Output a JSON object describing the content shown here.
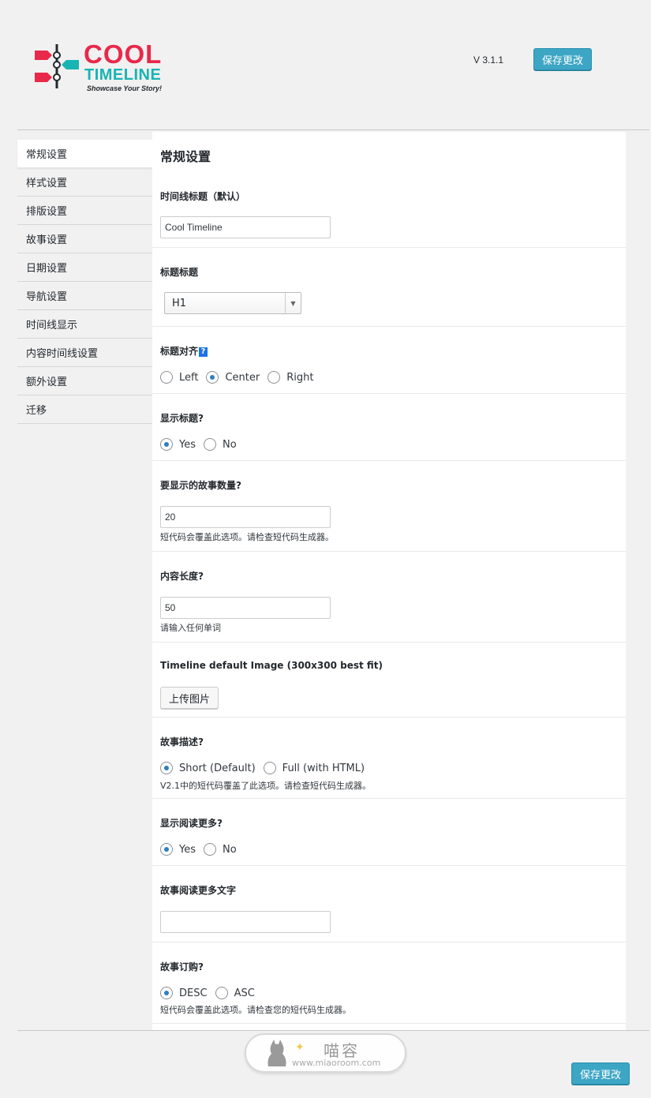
{
  "header": {
    "logo_word1": "COOL",
    "logo_word2": "TIMELINE",
    "logo_tagline": "Showcase Your Story!",
    "version": "V 3.1.1",
    "save_label": "保存更改"
  },
  "sidebar": {
    "items": [
      {
        "label": "常规设置",
        "active": true
      },
      {
        "label": "样式设置"
      },
      {
        "label": "排版设置"
      },
      {
        "label": "故事设置"
      },
      {
        "label": "日期设置"
      },
      {
        "label": "导航设置"
      },
      {
        "label": "时间线显示"
      },
      {
        "label": "内容时间线设置"
      },
      {
        "label": "额外设置"
      },
      {
        "label": "迁移"
      }
    ]
  },
  "main": {
    "title": "常规设置",
    "timeline_title": {
      "label": "时间线标题（默认）",
      "value": "Cool Timeline"
    },
    "heading_tag": {
      "label": "标题标题",
      "selected": "H1"
    },
    "title_align": {
      "label": "标题对齐",
      "help": "?",
      "options": [
        "Left",
        "Center",
        "Right"
      ],
      "selected": "Center"
    },
    "show_title": {
      "label": "显示标题?",
      "options": [
        "Yes",
        "No"
      ],
      "selected": "Yes"
    },
    "story_count": {
      "label": "要显示的故事数量?",
      "value": "20",
      "desc": "短代码会覆盖此选项。请检查短代码生成器。"
    },
    "content_length": {
      "label": "内容长度?",
      "value": "50",
      "desc": "请输入任何单词"
    },
    "default_image": {
      "label": "Timeline default Image (300x300 best fit)",
      "button": "上传图片"
    },
    "story_desc": {
      "label": "故事描述?",
      "options": [
        "Short (Default)",
        "Full (with HTML)"
      ],
      "selected": "Short (Default)",
      "desc": "V2.1中的短代码覆盖了此选项。请检查短代码生成器。"
    },
    "show_read_more": {
      "label": "显示阅读更多?",
      "options": [
        "Yes",
        "No"
      ],
      "selected": "Yes"
    },
    "read_more_text": {
      "label": "故事阅读更多文字",
      "value": ""
    },
    "story_order": {
      "label": "故事订购?",
      "options": [
        "DESC",
        "ASC"
      ],
      "selected": "DESC",
      "desc": "短代码会覆盖此选项。请检查您的短代码生成器。"
    }
  },
  "footer": {
    "save_label": "保存更改"
  },
  "watermark": {
    "text": "喵容",
    "url": "www.miaoroom.com"
  },
  "colors": {
    "accent": "#3ea6c5",
    "logo_red": "#e8294a",
    "logo_teal": "#18b4b4",
    "radio": "#2e7fbf"
  }
}
